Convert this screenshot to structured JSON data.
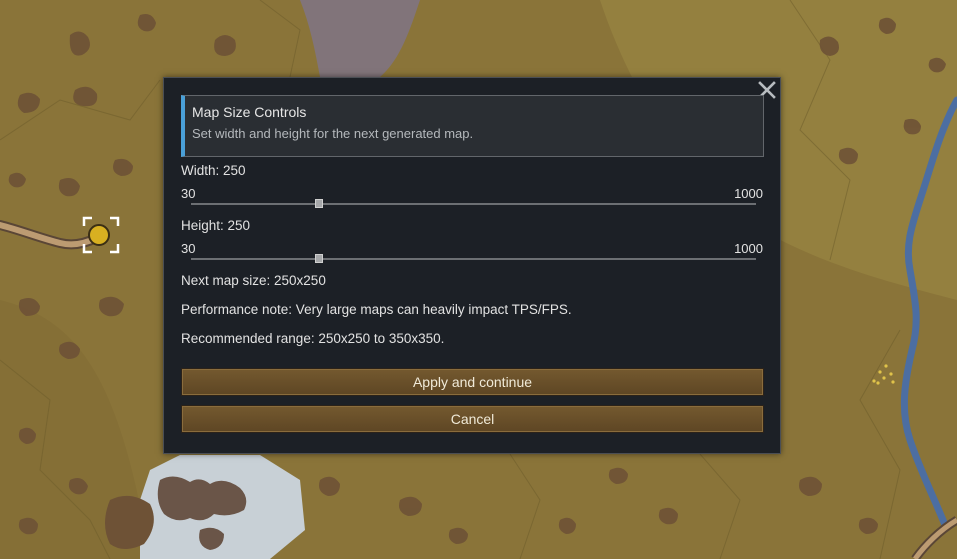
{
  "dialog": {
    "title": "Map Size Controls",
    "description": "Set width and height for the next generated map.",
    "width": {
      "label": "Width: 250",
      "min_label": "30",
      "max_label": "1000",
      "min": 30,
      "max": 1000,
      "value": 250
    },
    "height": {
      "label": "Height: 250",
      "min_label": "30",
      "max_label": "1000",
      "min": 30,
      "max": 1000,
      "value": 250
    },
    "next_map_size": "Next map size: 250x250",
    "performance_note": "Performance note: Very large maps can heavily impact TPS/FPS.",
    "recommended": "Recommended range: 250x250 to 350x350.",
    "apply_label": "Apply and continue",
    "cancel_label": "Cancel",
    "close_icon": "close-x-icon"
  },
  "world": {
    "selection_marker_icon": "target-brackets-icon",
    "colors": {
      "terrain": "#8f7a3c",
      "rough": "#6b4f36",
      "ice": "#c8d0d6",
      "river": "#4c6ea2",
      "marker": "#d8b021"
    }
  }
}
